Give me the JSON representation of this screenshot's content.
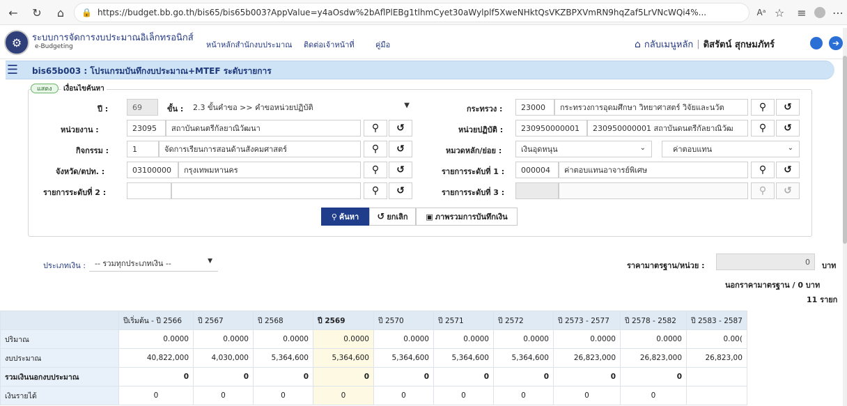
{
  "browser": {
    "url": "https://budget.bb.go.th/bis65/bis65b003?AppValue=y4aOsdw%2bAflPlEBg1tlhmCyet30aWylplf5XweNHktQsVKZBPXVmRN9hqZaf5LrVNcWQi4%...",
    "read_aloud": "Aᵃ"
  },
  "header": {
    "title": "ระบบการจัดการงบประมาณอิเล็กทรอนิกส์",
    "subtitle": "e-Budgeting",
    "nav": [
      "หน้าหลักสำนักงบประมาณ",
      "ติดต่อเจ้าหน้าที่",
      "คู่มือ"
    ],
    "back_menu": "กลับเมนูหลัก",
    "user": "ดิสรัตน์ สุกษมภัทร์"
  },
  "page_title": "bis65b003 : โปรแกรมบันทึกงบประมาณ+MTEF ระดับรายการ",
  "filter": {
    "toggle_label": "แสดง",
    "legend": "เงื่อนไขค้นหา",
    "year_label": "ปี :",
    "year_value": "69",
    "step_label": "ขั้น :",
    "step_value": "2.3 ขั้นคำขอ >> คำขอหน่วยปฏิบัติ",
    "ministry_label": "กระทรวง :",
    "ministry_code": "23000",
    "ministry_name": "กระทรวงการอุดมศึกษา วิทยาศาสตร์ วิจัยและนวัต",
    "agency_label": "หน่วยงาน :",
    "agency_code": "23095",
    "agency_name": "สถาบันดนตรีกัลยาณิวัฒนา",
    "unit_label": "หน่วยปฏิบัติ :",
    "unit_code": "230950000001",
    "unit_name": "230950000001 สถาบันดนตรีกัลยาณิวัฒ",
    "activity_label": "กิจกรรม :",
    "activity_code": "1",
    "activity_name": "จัดการเรียนการสอนด้านสังคมศาสตร์",
    "category_label": "หมวดหลัก/ย่อย :",
    "category_main": "เงินอุดหนุน",
    "category_sub": "ค่าตอบแทน",
    "province_label": "จังหวัด/ตปท. :",
    "province_code": "03100000",
    "province_name": "กรุงเทพมหานคร",
    "item1_label": "รายการระดับที่ 1 :",
    "item1_code": "000004",
    "item1_name": "ค่าตอบแทนอาจารย์พิเศษ",
    "item2_label": "รายการระดับที่ 2 :",
    "item2_code": "",
    "item2_name": "",
    "item3_label": "รายการระดับที่ 3 :",
    "item3_code": "",
    "item3_name": "",
    "search_button": "ค้นหา",
    "cancel_button": "ยกเลิก",
    "overview_button": "ภาพรวมการบันทึกเงิน"
  },
  "money_type": {
    "label": "ประเภทเงิน :",
    "value": "-- รวมทุกประเภทเงิน --"
  },
  "standard_price": {
    "label": "ราคามาตรฐาน/หน่วย :",
    "value": "0",
    "unit": "บาท",
    "note": "นอกราคามาตรฐาน / 0 บาท",
    "count": "11",
    "count_unit": "รายก"
  },
  "table": {
    "headers": [
      "",
      "ปีเริ่มต้น - ปี 2566",
      "ปี 2567",
      "ปี 2568",
      "ปี 2569",
      "ปี 2570",
      "ปี 2571",
      "ปี 2572",
      "ปี 2573 - 2577",
      "ปี 2578 - 2582",
      "ปี 2583 - 2587"
    ],
    "rows": [
      {
        "label": "ปริมาณ",
        "bold": false,
        "values": [
          "0.0000",
          "0.0000",
          "0.0000",
          "0.0000",
          "0.0000",
          "0.0000",
          "0.0000",
          "0.0000",
          "0.0000",
          "0.00("
        ]
      },
      {
        "label": "งบประมาณ",
        "bold": false,
        "values": [
          "40,822,000",
          "4,030,000",
          "5,364,600",
          "5,364,600",
          "5,364,600",
          "5,364,600",
          "5,364,600",
          "26,823,000",
          "26,823,000",
          "26,823,00"
        ]
      },
      {
        "label": "รวมเงินนอกงบประมาณ",
        "bold": true,
        "values": [
          "0",
          "0",
          "0",
          "0",
          "0",
          "0",
          "0",
          "0",
          "0",
          ""
        ]
      },
      {
        "label": "เงินรายได้",
        "bold": false,
        "values": [
          "0",
          "0",
          "0",
          "0",
          "0",
          "0",
          "0",
          "0",
          "0",
          ""
        ]
      }
    ]
  }
}
